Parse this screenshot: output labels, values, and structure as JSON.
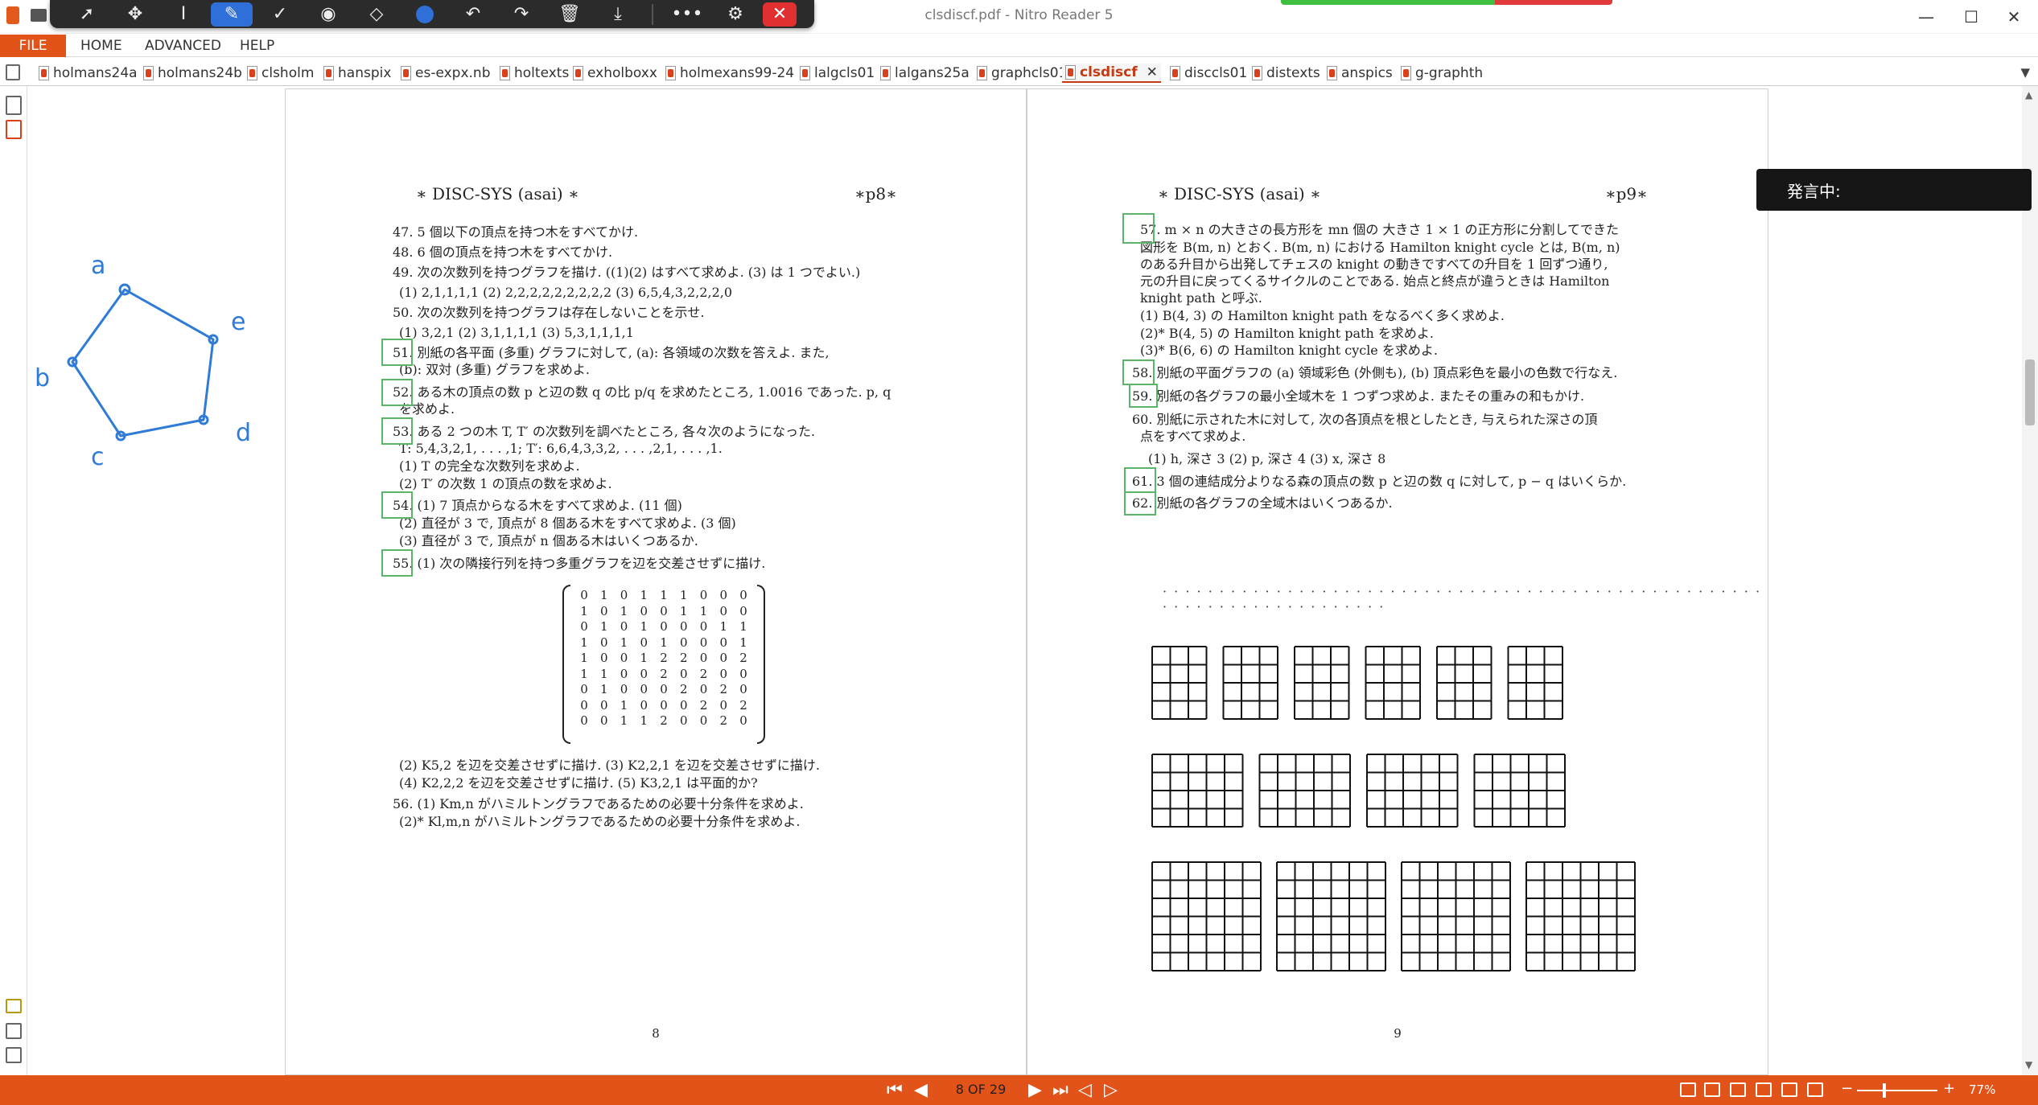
{
  "window": {
    "title": "clsdiscf.pdf - Nitro Reader 5",
    "minimize": "—",
    "maximize": "☐",
    "close": "✕"
  },
  "ribbon": {
    "file": "FILE",
    "tabs": [
      "HOME",
      "ADVANCED",
      "HELP"
    ]
  },
  "doc_tabs": [
    "holmans24a",
    "holmans24b",
    "clsholm",
    "hanspix",
    "es-expx.nb",
    "holtexts",
    "exholboxx",
    "holmexans99-24",
    "lalgcls01",
    "lalgans25a",
    "graphcls01",
    "clsdiscf",
    "disccls01",
    "distexts",
    "anspics",
    "g-graphth"
  ],
  "active_tab": "clsdiscf",
  "page8": {
    "header_left": "∗ DISC-SYS (asai) ∗",
    "header_right": "∗p8∗",
    "lines": [
      "47. 5 個以下の頂点を持つ木をすべてかけ.",
      "48. 6 個の頂点を持つ木をすべてかけ.",
      "49. 次の次数列を持つグラフを描け. ((1)(2) はすべて求めよ. (3) は 1 つでよい.)",
      "(1) 2,1,1,1,1       (2) 2,2,2,2,2,2,2,2,2       (3) 6,5,4,3,2,2,2,0",
      "50. 次の次数列を持つグラフは存在しないことを示せ.",
      "(1) 3,2,1       (2) 3,1,1,1,1       (3) 5,3,1,1,1,1",
      "51. 別紙の各平面 (多重) グラフに対して, (a): 各領域の次数を答えよ. また,",
      "(b): 双対 (多重) グラフを求めよ.",
      "52. ある木の頂点の数 p と辺の数 q の比 p/q を求めたところ, 1.0016 であった. p, q",
      "を求めよ.",
      "53. ある 2 つの木 T, T′ の次数列を調べたところ, 各々次のようになった.",
      "T: 5,4,3,2,1, . . . ,1;  T′: 6,6,4,3,3,2, . . . ,2,1, . . . ,1.",
      "(1) T の完全な次数列を求めよ.",
      "(2) T′ の次数 1 の頂点の数を求めよ.",
      "54. (1) 7 頂点からなる木をすべて求めよ. (11 個)",
      "(2) 直径が 3 で, 頂点が 8 個ある木をすべて求めよ. (3 個)",
      "(3) 直径が 3 で, 頂点が n 個ある木はいくつあるか.",
      "55. (1) 次の隣接行列を持つ多重グラフを辺を交差させずに描け.",
      "(2) K5,2 を辺を交差させずに描け.     (3) K2,2,1 を辺を交差させずに描け.",
      "(4) K2,2,2 を辺を交差させずに描け.     (5) K3,2,1 は平面的か?",
      "56. (1) Km,n がハミルトングラフであるための必要十分条件を求めよ.",
      "(2)* Kl,m,n がハミルトングラフであるための必要十分条件を求めよ."
    ],
    "matrix": [
      [
        "0",
        "1",
        "0",
        "1",
        "1",
        "1",
        "0",
        "0",
        "0"
      ],
      [
        "1",
        "0",
        "1",
        "0",
        "0",
        "1",
        "1",
        "0",
        "0"
      ],
      [
        "0",
        "1",
        "0",
        "1",
        "0",
        "0",
        "0",
        "1",
        "1"
      ],
      [
        "1",
        "0",
        "1",
        "0",
        "1",
        "0",
        "0",
        "0",
        "1"
      ],
      [
        "1",
        "0",
        "0",
        "1",
        "2",
        "2",
        "0",
        "0",
        "2"
      ],
      [
        "1",
        "1",
        "0",
        "0",
        "2",
        "0",
        "2",
        "0",
        "0"
      ],
      [
        "0",
        "1",
        "0",
        "0",
        "0",
        "2",
        "0",
        "2",
        "0"
      ],
      [
        "0",
        "0",
        "1",
        "0",
        "0",
        "0",
        "2",
        "0",
        "2"
      ],
      [
        "0",
        "0",
        "1",
        "1",
        "2",
        "0",
        "0",
        "2",
        "0"
      ]
    ],
    "page_number": "8"
  },
  "page9": {
    "header_left": "∗ DISC-SYS (asai) ∗",
    "header_right": "∗p9∗",
    "lines": [
      "57. m × n の大きさの長方形を mn 個の 大きさ 1 × 1 の正方形に分割してできた",
      "図形を B(m, n) とおく. B(m, n) における Hamilton knight cycle とは, B(m, n)",
      "のある升目から出発してチェスの knight の動きですべての升目を 1 回ずつ通り,",
      "元の升目に戻ってくるサイクルのことである. 始点と終点が違うときは Hamilton",
      "knight path と呼ぶ.",
      "(1) B(4, 3) の Hamilton knight path をなるべく多く求めよ.",
      "(2)* B(4, 5) の Hamilton knight path を求めよ.",
      "(3)* B(6, 6) の Hamilton knight cycle を求めよ.",
      "58. 別紙の平面グラフの (a) 領域彩色 (外側も), (b) 頂点彩色を最小の色数で行なえ.",
      "59. 別紙の各グラフの最小全域木を 1 つずつ求めよ. またその重みの和もかけ.",
      "60. 別紙に示された木に対して, 次の各頂点を根としたとき, 与えられた深さの頂",
      "点をすべて求めよ.",
      "(1) h, 深さ 3    (2) p, 深さ 4    (3) x, 深さ 8",
      "61. 3 個の連結成分よりなる森の頂点の数 p と辺の数 q に対して, p − q はいくらか.",
      "62. 別紙の各グラフの全域木はいくつあるか."
    ],
    "dotted": "· · · · · · · · · · · · · · · · · · · · · · · · · · · · · · · · · · · · · · · · · · · · · · · · · · · · · · · · · · · · · · · · · · · · · · · · ·",
    "boards": [
      {
        "rows": 4,
        "cols": 3,
        "count": 6
      },
      {
        "rows": 4,
        "cols": 5,
        "count": 4
      },
      {
        "rows": 6,
        "cols": 6,
        "count": 4
      }
    ],
    "page_number": "9"
  },
  "sketch_labels": [
    "a",
    "e",
    "d",
    "c",
    "b"
  ],
  "speaking_label": "発言中:",
  "status": {
    "page_indicator": "8 OF 29",
    "zoom": "77%"
  },
  "colors": {
    "accent": "#e2531a",
    "annotation_box": "#5ab56a",
    "ink": "#2f7bd6"
  }
}
